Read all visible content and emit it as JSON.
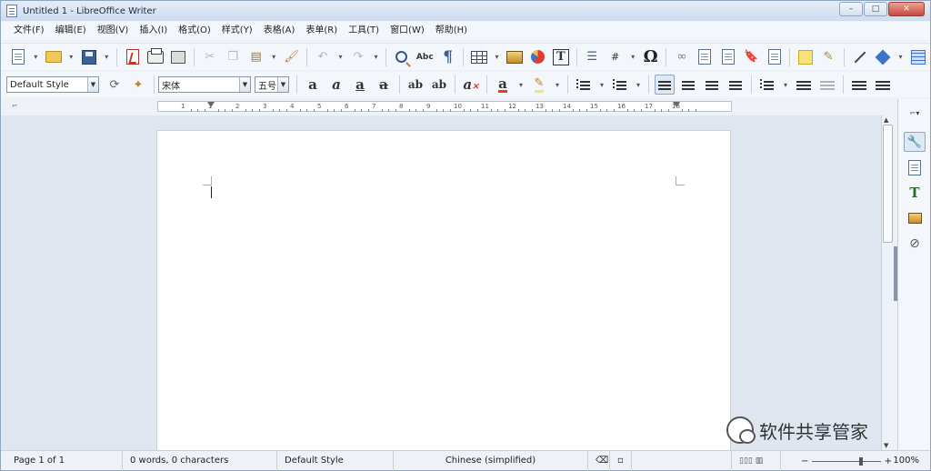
{
  "window": {
    "title": "Untitled 1 - LibreOffice Writer",
    "minimize": "–",
    "maximize": "□",
    "close": "✕"
  },
  "menu": [
    "文件(F)",
    "编辑(E)",
    "视图(V)",
    "插入(I)",
    "格式(O)",
    "样式(Y)",
    "表格(A)",
    "表单(R)",
    "工具(T)",
    "窗口(W)",
    "帮助(H)"
  ],
  "format_bar": {
    "paragraph_style": "Default Style",
    "font_name": "宋体",
    "font_size": "五号",
    "spell_label": "Abc"
  },
  "ruler": {
    "numbers": [
      "1",
      "1",
      "2",
      "3",
      "4",
      "5",
      "6",
      "7",
      "8",
      "9",
      "10",
      "11",
      "12",
      "13",
      "14",
      "15",
      "16",
      "17",
      "18"
    ]
  },
  "statusbar": {
    "page": "Page 1 of 1",
    "words": "0 words, 0 characters",
    "style": "Default Style",
    "language": "Chinese (simplified)",
    "zoom_minus": "−",
    "zoom_plus": "+",
    "zoom": "100%"
  },
  "watermark": {
    "text": "软件共享管家"
  },
  "colors": {
    "accent": "#3d73c8",
    "titlebar": "#cfdcee",
    "close": "#c9473a",
    "font_color_red": "#e23b2a",
    "highlight_yellow": "#f7e27a"
  }
}
